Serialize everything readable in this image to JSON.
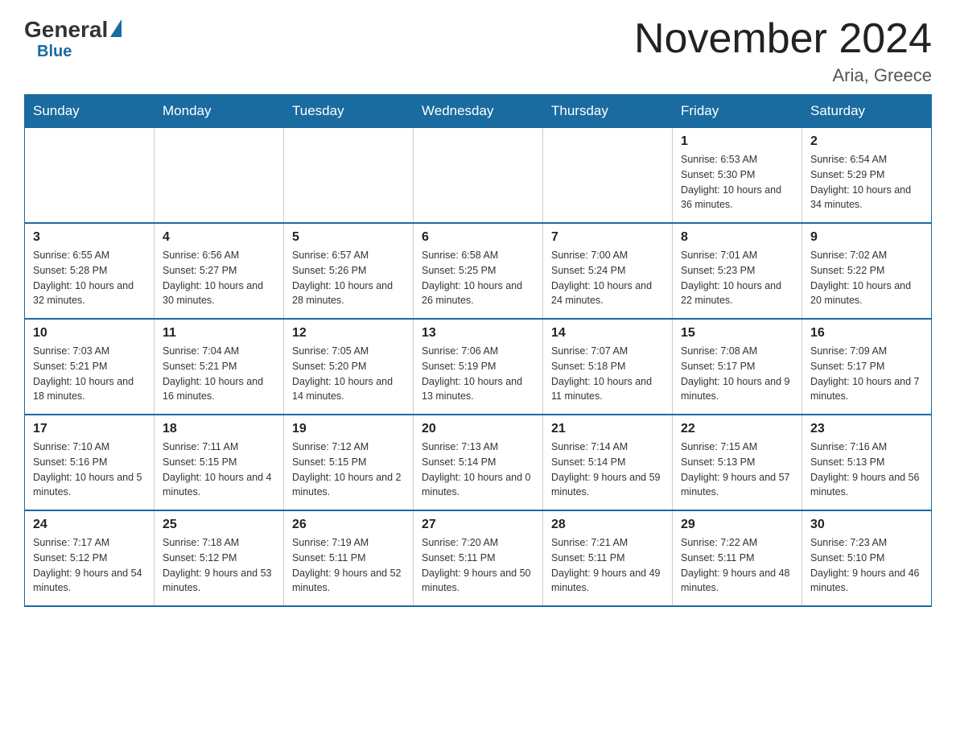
{
  "header": {
    "month_title": "November 2024",
    "location": "Aria, Greece",
    "logo_general": "General",
    "logo_blue": "Blue"
  },
  "days_of_week": [
    "Sunday",
    "Monday",
    "Tuesday",
    "Wednesday",
    "Thursday",
    "Friday",
    "Saturday"
  ],
  "weeks": [
    [
      {
        "day": "",
        "detail": ""
      },
      {
        "day": "",
        "detail": ""
      },
      {
        "day": "",
        "detail": ""
      },
      {
        "day": "",
        "detail": ""
      },
      {
        "day": "",
        "detail": ""
      },
      {
        "day": "1",
        "detail": "Sunrise: 6:53 AM\nSunset: 5:30 PM\nDaylight: 10 hours and 36 minutes."
      },
      {
        "day": "2",
        "detail": "Sunrise: 6:54 AM\nSunset: 5:29 PM\nDaylight: 10 hours and 34 minutes."
      }
    ],
    [
      {
        "day": "3",
        "detail": "Sunrise: 6:55 AM\nSunset: 5:28 PM\nDaylight: 10 hours and 32 minutes."
      },
      {
        "day": "4",
        "detail": "Sunrise: 6:56 AM\nSunset: 5:27 PM\nDaylight: 10 hours and 30 minutes."
      },
      {
        "day": "5",
        "detail": "Sunrise: 6:57 AM\nSunset: 5:26 PM\nDaylight: 10 hours and 28 minutes."
      },
      {
        "day": "6",
        "detail": "Sunrise: 6:58 AM\nSunset: 5:25 PM\nDaylight: 10 hours and 26 minutes."
      },
      {
        "day": "7",
        "detail": "Sunrise: 7:00 AM\nSunset: 5:24 PM\nDaylight: 10 hours and 24 minutes."
      },
      {
        "day": "8",
        "detail": "Sunrise: 7:01 AM\nSunset: 5:23 PM\nDaylight: 10 hours and 22 minutes."
      },
      {
        "day": "9",
        "detail": "Sunrise: 7:02 AM\nSunset: 5:22 PM\nDaylight: 10 hours and 20 minutes."
      }
    ],
    [
      {
        "day": "10",
        "detail": "Sunrise: 7:03 AM\nSunset: 5:21 PM\nDaylight: 10 hours and 18 minutes."
      },
      {
        "day": "11",
        "detail": "Sunrise: 7:04 AM\nSunset: 5:21 PM\nDaylight: 10 hours and 16 minutes."
      },
      {
        "day": "12",
        "detail": "Sunrise: 7:05 AM\nSunset: 5:20 PM\nDaylight: 10 hours and 14 minutes."
      },
      {
        "day": "13",
        "detail": "Sunrise: 7:06 AM\nSunset: 5:19 PM\nDaylight: 10 hours and 13 minutes."
      },
      {
        "day": "14",
        "detail": "Sunrise: 7:07 AM\nSunset: 5:18 PM\nDaylight: 10 hours and 11 minutes."
      },
      {
        "day": "15",
        "detail": "Sunrise: 7:08 AM\nSunset: 5:17 PM\nDaylight: 10 hours and 9 minutes."
      },
      {
        "day": "16",
        "detail": "Sunrise: 7:09 AM\nSunset: 5:17 PM\nDaylight: 10 hours and 7 minutes."
      }
    ],
    [
      {
        "day": "17",
        "detail": "Sunrise: 7:10 AM\nSunset: 5:16 PM\nDaylight: 10 hours and 5 minutes."
      },
      {
        "day": "18",
        "detail": "Sunrise: 7:11 AM\nSunset: 5:15 PM\nDaylight: 10 hours and 4 minutes."
      },
      {
        "day": "19",
        "detail": "Sunrise: 7:12 AM\nSunset: 5:15 PM\nDaylight: 10 hours and 2 minutes."
      },
      {
        "day": "20",
        "detail": "Sunrise: 7:13 AM\nSunset: 5:14 PM\nDaylight: 10 hours and 0 minutes."
      },
      {
        "day": "21",
        "detail": "Sunrise: 7:14 AM\nSunset: 5:14 PM\nDaylight: 9 hours and 59 minutes."
      },
      {
        "day": "22",
        "detail": "Sunrise: 7:15 AM\nSunset: 5:13 PM\nDaylight: 9 hours and 57 minutes."
      },
      {
        "day": "23",
        "detail": "Sunrise: 7:16 AM\nSunset: 5:13 PM\nDaylight: 9 hours and 56 minutes."
      }
    ],
    [
      {
        "day": "24",
        "detail": "Sunrise: 7:17 AM\nSunset: 5:12 PM\nDaylight: 9 hours and 54 minutes."
      },
      {
        "day": "25",
        "detail": "Sunrise: 7:18 AM\nSunset: 5:12 PM\nDaylight: 9 hours and 53 minutes."
      },
      {
        "day": "26",
        "detail": "Sunrise: 7:19 AM\nSunset: 5:11 PM\nDaylight: 9 hours and 52 minutes."
      },
      {
        "day": "27",
        "detail": "Sunrise: 7:20 AM\nSunset: 5:11 PM\nDaylight: 9 hours and 50 minutes."
      },
      {
        "day": "28",
        "detail": "Sunrise: 7:21 AM\nSunset: 5:11 PM\nDaylight: 9 hours and 49 minutes."
      },
      {
        "day": "29",
        "detail": "Sunrise: 7:22 AM\nSunset: 5:11 PM\nDaylight: 9 hours and 48 minutes."
      },
      {
        "day": "30",
        "detail": "Sunrise: 7:23 AM\nSunset: 5:10 PM\nDaylight: 9 hours and 46 minutes."
      }
    ]
  ]
}
